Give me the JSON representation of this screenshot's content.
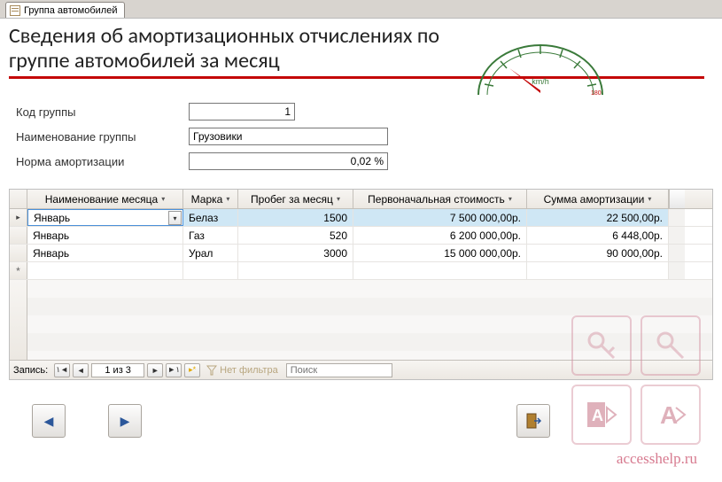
{
  "tab": {
    "label": "Группа автомобилей"
  },
  "header": {
    "title": "Сведения об амортизационных отчислениях по группе автомобилей за месяц"
  },
  "fields": {
    "group_code_label": "Код группы",
    "group_code_value": "1",
    "group_name_label": "Наименование группы",
    "group_name_value": "Грузовики",
    "amort_rate_label": "Норма амортизации",
    "amort_rate_value": "0,02 %"
  },
  "grid": {
    "columns": {
      "month": "Наименование месяца",
      "brand": "Марка",
      "mileage": "Пробег за месяц",
      "cost": "Первоначальная стоимость",
      "amort": "Сумма амортизации"
    },
    "rows": [
      {
        "month": "Январь",
        "brand": "Белаз",
        "mileage": "1500",
        "cost": "7 500 000,00р.",
        "amort": "22 500,00р."
      },
      {
        "month": "Январь",
        "brand": "Газ",
        "mileage": "520",
        "cost": "6 200 000,00р.",
        "amort": "6 448,00р."
      },
      {
        "month": "Январь",
        "brand": "Урал",
        "mileage": "3000",
        "cost": "15 000 000,00р.",
        "amort": "90 000,00р."
      }
    ]
  },
  "nav": {
    "label": "Запись:",
    "position": "1 из 3",
    "no_filter": "Нет фильтра",
    "search_placeholder": "Поиск"
  },
  "watermark": "accesshelp.ru"
}
